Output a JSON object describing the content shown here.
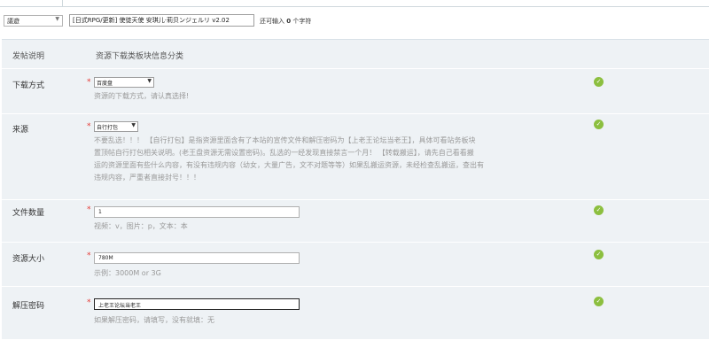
{
  "category": {
    "selected": "議遊"
  },
  "thread_title": {
    "value": "[日式RPG/更新] 使徒天使 安琪儿·莉贝ンジェルリ v2.02"
  },
  "title_counter": {
    "prefix": "还可输入",
    "count": "0",
    "suffix": "个字符"
  },
  "section": {
    "label": "发帖说明",
    "heading": "资源下载类板块信息分类"
  },
  "fields": {
    "download": {
      "label": "下载方式",
      "value": "百度盘",
      "hint": "资源的下载方式，请认真选择!"
    },
    "source": {
      "label": "来源",
      "value": "自行打包",
      "hint": [
        "不要乱选！！！ 【自行打包】是指资源里面含有了本站的宣传文件和解压密码为【上老王论坛当老王】，具体可看站务板块",
        "置顶帖自行打包相关说明。(老王盘资源无需设置密码)。乱选的一经发现直接禁言一个月！ 【转载搬运】，请先自己看看搬",
        "运的资源里面有些什么内容，有没有违规内容（幼女，大量广告，文不对题等等）如果乱搬运资源，未经检查乱搬运，查出有",
        "违规内容，严重者直接封号！！！"
      ]
    },
    "file_count": {
      "label": "文件数量",
      "value": "1",
      "hint": "视频：v，图片：p，文本：本"
    },
    "size": {
      "label": "资源大小",
      "value": "780M",
      "hint": "示例：3000M or 3G"
    },
    "password": {
      "label": "解压密码",
      "value": "上老王论坛当老王",
      "hint": "如果解压密码，请填写，没有就填：无"
    }
  },
  "required_mark": "*",
  "valid_icon": "check-circle-icon",
  "colors": {
    "panel_bg": "#eef2f5",
    "required": "#e53935",
    "valid": "#8cbf3f"
  }
}
